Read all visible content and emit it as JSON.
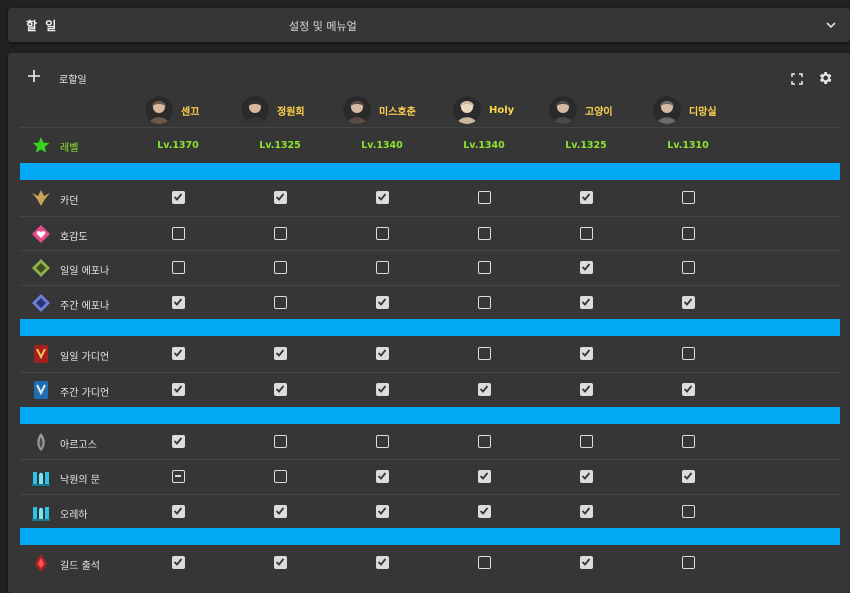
{
  "topbar": {
    "title": "할 일",
    "menu_label": "설정 및 메뉴얼"
  },
  "panel": {
    "title": "로할일"
  },
  "characters": [
    {
      "name": "센끄",
      "level": "Lv.1370"
    },
    {
      "name": "정원희",
      "level": "Lv.1325"
    },
    {
      "name": "미스호춘",
      "level": "Lv.1340"
    },
    {
      "name": "Holy",
      "level": "Lv.1340"
    },
    {
      "name": "고양이",
      "level": "Lv.1325"
    },
    {
      "name": "디망실",
      "level": "Lv.1310"
    }
  ],
  "level_row": {
    "label": "레벨"
  },
  "groups": [
    {
      "tasks": [
        {
          "name": "카던",
          "icon": "chaos-dungeon-icon",
          "states": [
            "on",
            "on",
            "on",
            "off",
            "on",
            "off"
          ]
        },
        {
          "name": "호감도",
          "icon": "rapport-heart-icon",
          "states": [
            "off",
            "off",
            "off",
            "off",
            "off",
            "off"
          ]
        },
        {
          "name": "일일 에포나",
          "icon": "daily-epona-icon",
          "states": [
            "off",
            "off",
            "off",
            "off",
            "on",
            "off"
          ]
        },
        {
          "name": "주간 에포나",
          "icon": "weekly-epona-icon",
          "states": [
            "on",
            "off",
            "on",
            "off",
            "on",
            "on"
          ]
        }
      ]
    },
    {
      "tasks": [
        {
          "name": "일일 가디언",
          "icon": "daily-guardian-icon",
          "states": [
            "on",
            "on",
            "on",
            "off",
            "on",
            "off"
          ]
        },
        {
          "name": "주간 가디언",
          "icon": "weekly-guardian-icon",
          "states": [
            "on",
            "on",
            "on",
            "on",
            "on",
            "on"
          ]
        }
      ]
    },
    {
      "tasks": [
        {
          "name": "아르고스",
          "icon": "argos-icon",
          "states": [
            "on",
            "off",
            "off",
            "off",
            "off",
            "off"
          ]
        },
        {
          "name": "낙원의 문",
          "icon": "paradise-gate-icon",
          "states": [
            "partial",
            "off",
            "on",
            "on",
            "on",
            "on"
          ]
        },
        {
          "name": "오레하",
          "icon": "oreha-icon",
          "states": [
            "on",
            "on",
            "on",
            "on",
            "on",
            "off"
          ]
        }
      ]
    },
    {
      "tasks": [
        {
          "name": "길드 출석",
          "icon": "guild-attendance-icon",
          "states": [
            "on",
            "on",
            "on",
            "off",
            "on",
            "off"
          ]
        }
      ]
    }
  ],
  "colors": {
    "accent": "#03a9f4",
    "character_name": "#ffd34d",
    "level": "#8de22f",
    "background": "#212121",
    "panel": "#363636"
  }
}
